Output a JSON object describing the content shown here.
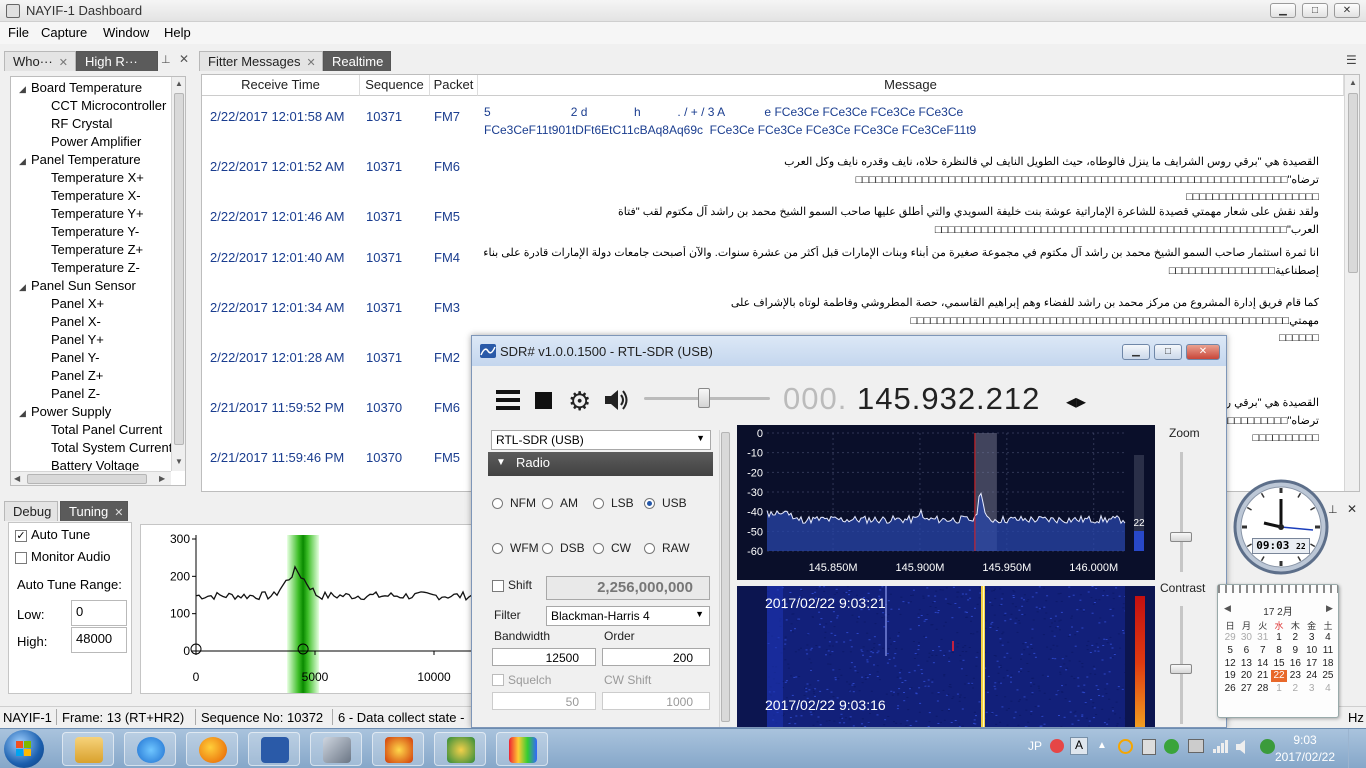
{
  "window": {
    "title": "NAYIF-1 Dashboard",
    "buttons": {
      "minimize": "▁",
      "maximize": "□",
      "close": "✕"
    }
  },
  "menu": [
    "File",
    "Capture",
    "Window",
    "Help"
  ],
  "left_tabs": [
    {
      "label": "Who···",
      "close": "✕"
    },
    {
      "label": "High R···",
      "close": "✕"
    }
  ],
  "tree": [
    {
      "label": "Board Temperature",
      "level": 0
    },
    {
      "label": "CCT Microcontroller",
      "level": 1
    },
    {
      "label": "RF Crystal",
      "level": 1
    },
    {
      "label": "Power Amplifier",
      "level": 1
    },
    {
      "label": "Panel Temperature",
      "level": 0
    },
    {
      "label": "Temperature X+",
      "level": 1
    },
    {
      "label": "Temperature X-",
      "level": 1
    },
    {
      "label": "Temperature Y+",
      "level": 1
    },
    {
      "label": "Temperature Y-",
      "level": 1
    },
    {
      "label": "Temperature Z+",
      "level": 1
    },
    {
      "label": "Temperature Z-",
      "level": 1
    },
    {
      "label": "Panel Sun Sensor",
      "level": 0
    },
    {
      "label": "Panel X+",
      "level": 1
    },
    {
      "label": "Panel X-",
      "level": 1
    },
    {
      "label": "Panel Y+",
      "level": 1
    },
    {
      "label": "Panel Y-",
      "level": 1
    },
    {
      "label": "Panel Z+",
      "level": 1
    },
    {
      "label": "Panel Z-",
      "level": 1
    },
    {
      "label": "Power Supply",
      "level": 0
    },
    {
      "label": "Total Panel Current",
      "level": 1
    },
    {
      "label": "Total System Current",
      "level": 1
    },
    {
      "label": "Battery Voltage",
      "level": 1
    }
  ],
  "main_tabs": [
    {
      "label": "Fitter Messages",
      "close": "✕"
    },
    {
      "label": "Realtime"
    }
  ],
  "table": {
    "headers": [
      "Receive Time",
      "Sequence",
      "Packet",
      "Message"
    ],
    "rows": [
      {
        "time": "2/22/2017 12:01:58 AM",
        "seq": "10371",
        "packet": "FM7",
        "msg": [
          "5                        2 d              h           . / + / 3 A            e FCe3Ce FCe3Ce FCe3Ce FCe3Ce",
          "FCe3CeF11t901tDFt6EtC11cBAq8Aq69c  FCe3Ce FCe3Ce FCe3Ce FCe3Ce FCe3CeF11t9"
        ],
        "ar": false
      },
      {
        "time": "2/22/2017 12:01:52 AM",
        "seq": "10371",
        "packet": "FM6",
        "msg": [
          "القصيدة هي \"برقي روس الشرايف ما ينزل فالوطاه، حيث الطويل النايف لي فالنظرة حلاه، نايف وقدره نايف وكل العرب",
          "ترضاه\"□□□□□□□□□□□□□□□□□□□□□□□□□□□□□□□□□□□□□□□□□□□□□□□□□□□□□□□□□□□□□□□□□",
          "□□□□□□□□□□□□□□□□□□□□"
        ],
        "ar": true
      },
      {
        "time": "2/22/2017 12:01:46 AM",
        "seq": "10371",
        "packet": "FM5",
        "msg": [
          "ولقد نقش على شعار مهمتي قصيدة للشاعرة الإماراتية عوشة بنت خليفة السويدي والتي أطلق عليها صاحب السمو الشيخ محمد بن راشد آل مكتوم لقب \"فتاة",
          "العرب\"□□□□□□□□□□□□□□□□□□□□□□□□□□□□□□□□□□□□□□□□□□□□□□□□□□□□□"
        ],
        "ar": true
      },
      {
        "time": "2/22/2017 12:01:40 AM",
        "seq": "10371",
        "packet": "FM4",
        "msg": [
          "انا ثمرة استثمار صاحب السمو الشيخ محمد بن راشد آل مكتوم في مجموعة صغيرة من أبناء وبنات الإمارات قبل أكثر من عشرة سنوات. والآن أصبحت جامعات دولة الإمارات قادرة على بناء أقمار",
          "إصطناعية□□□□□□□□□□□□□□□□"
        ],
        "ar": true
      },
      {
        "time": "2/22/2017 12:01:34 AM",
        "seq": "10371",
        "packet": "FM3",
        "msg": [
          "كما قام فريق إدارة المشروع من مركز محمد بن راشد للفضاء وهم إبراهيم القاسمي، حصة المطروشي وفاطمة لوتاه بالإشراف على",
          "مهمتي□□□□□□□□□□□□□□□□□□□□□□□□□□□□□□□□□□□□□□□□□□□□□□□□□□□□□□□□□",
          "□□□□□□"
        ],
        "ar": true
      },
      {
        "time": "2/22/2017 12:01:28 AM",
        "seq": "10371",
        "packet": "FM2",
        "msg": [
          ""
        ],
        "ar": true
      },
      {
        "time": "2/21/2017 11:59:52 PM",
        "seq": "10370",
        "packet": "FM6",
        "msg": [
          "القصيدة هي \"برقي رو",
          "ترضاه\"□□□□□□□□□□",
          "□□□□□□□□□□"
        ],
        "ar": true
      },
      {
        "time": "2/21/2017 11:59:46 PM",
        "seq": "10370",
        "packet": "FM5",
        "msg": [
          ""
        ],
        "ar": true
      }
    ]
  },
  "bottom_tabs": [
    {
      "label": "Debug"
    },
    {
      "label": "Tuning",
      "close": "✕"
    }
  ],
  "tuning": {
    "auto_tune": {
      "label": "Auto Tune",
      "checked": true
    },
    "monitor_audio": {
      "label": "Monitor Audio",
      "checked": false
    },
    "range_label": "Auto Tune Range:",
    "low_label": "Low:",
    "low_value": "0",
    "high_label": "High:",
    "high_value": "48000",
    "plot": {
      "y_ticks": [
        "300",
        "200",
        "100",
        "0"
      ],
      "x_ticks": [
        "0",
        "5000",
        "10000"
      ],
      "marker_x": 4500
    }
  },
  "status": [
    "NAYIF-1",
    "Frame: 13 (RT+HR2)",
    "Sequence No:  10372",
    "6 - Data collect state -"
  ],
  "status_right": "Hz",
  "sdr": {
    "title": "SDR# v1.0.0.1500 - RTL-SDR (USB)",
    "freq_dim": "000.",
    "freq": "145.932.212",
    "source": "RTL-SDR (USB)",
    "radio_header": "Radio",
    "modes": [
      {
        "label": "NFM",
        "on": false
      },
      {
        "label": "AM",
        "on": false
      },
      {
        "label": "LSB",
        "on": false
      },
      {
        "label": "USB",
        "on": true
      },
      {
        "label": "WFM",
        "on": false
      },
      {
        "label": "DSB",
        "on": false
      },
      {
        "label": "CW",
        "on": false
      },
      {
        "label": "RAW",
        "on": false
      }
    ],
    "shift_label": "Shift",
    "shift_value": "2,256,000,000",
    "filter_label": "Filter",
    "filter_value": "Blackman-Harris 4",
    "bandwidth_label": "Bandwidth",
    "bandwidth_value": "12500",
    "order_label": "Order",
    "order_value": "200",
    "squelch_label": "Squelch",
    "squelch_value": "50",
    "cwshift_label": "CW Shift",
    "cwshift_value": "1000",
    "spectrum": {
      "y_ticks": [
        "0",
        "-10",
        "-20",
        "-30",
        "-40",
        "-50",
        "-60"
      ],
      "x_ticks": [
        "145.850M",
        "145.900M",
        "145.950M",
        "146.000M"
      ],
      "level": "22"
    },
    "waterfall_times": [
      "2017/02/22 9:03:21",
      "2017/02/22 9:03:16"
    ],
    "zoom_label": "Zoom",
    "contrast_label": "Contrast"
  },
  "clock": {
    "digital": "09:03",
    "seconds": "22"
  },
  "calendar": {
    "month": "17 2月",
    "weekdays": [
      "日",
      "月",
      "火",
      "水",
      "木",
      "金",
      "土"
    ],
    "weeks": [
      [
        "29",
        "30",
        "31",
        "1",
        "2",
        "3",
        "4"
      ],
      [
        "5",
        "6",
        "7",
        "8",
        "9",
        "10",
        "11"
      ],
      [
        "12",
        "13",
        "14",
        "15",
        "16",
        "17",
        "18"
      ],
      [
        "19",
        "20",
        "21",
        "22",
        "23",
        "24",
        "25"
      ],
      [
        "26",
        "27",
        "28",
        "1",
        "2",
        "3",
        "4"
      ]
    ],
    "today": "22"
  },
  "taskbar": {
    "lang": "JP",
    "time": "9:03",
    "date": "2017/02/22",
    "icons": [
      "explorer-icon",
      "ie-icon",
      "firefox-icon",
      "sdr-icon",
      "satellite-icon",
      "sunburst-icon",
      "antenna-icon",
      "paint-icon"
    ]
  },
  "colors": {
    "link": "#1a3d8f",
    "tab_active": "#5b5b5b",
    "spectrum_bg": "#0a0f2a",
    "waterfall_bg": "#12207a"
  }
}
